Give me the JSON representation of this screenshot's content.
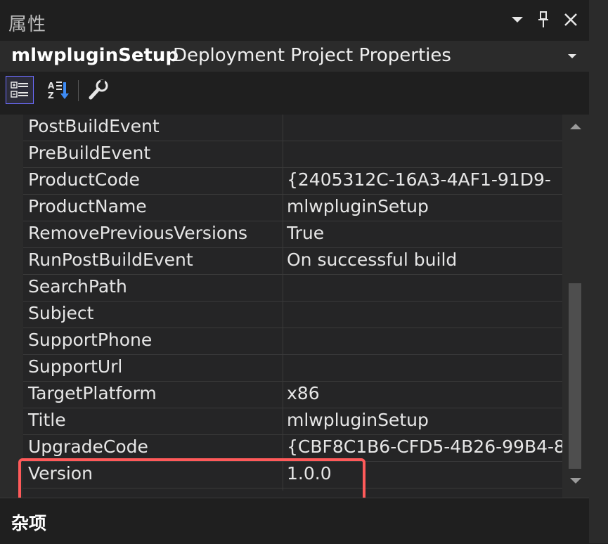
{
  "window": {
    "title": "属性",
    "dropdown_icon": "chevron-down-icon",
    "pin_icon": "pin-icon",
    "close_icon": "close-icon"
  },
  "object_selector": {
    "name": "mlwpluginSetup",
    "type": "Deployment Project Properties"
  },
  "toolbar": {
    "categorized_icon": "categorized-view-icon",
    "alphabetical_icon": "alphabetical-sort-icon",
    "property_pages_icon": "wrench-icon"
  },
  "properties": [
    {
      "name": "PostBuildEvent",
      "value": ""
    },
    {
      "name": "PreBuildEvent",
      "value": ""
    },
    {
      "name": "ProductCode",
      "value": "{2405312C-16A3-4AF1-91D9-"
    },
    {
      "name": "ProductName",
      "value": "mlwpluginSetup"
    },
    {
      "name": "RemovePreviousVersions",
      "value": "True"
    },
    {
      "name": "RunPostBuildEvent",
      "value": "On successful build"
    },
    {
      "name": "SearchPath",
      "value": ""
    },
    {
      "name": "Subject",
      "value": ""
    },
    {
      "name": "SupportPhone",
      "value": ""
    },
    {
      "name": "SupportUrl",
      "value": ""
    },
    {
      "name": "TargetPlatform",
      "value": "x86"
    },
    {
      "name": "Title",
      "value": "mlwpluginSetup"
    },
    {
      "name": "UpgradeCode",
      "value": "{CBF8C1B6-CFD5-4B26-99B4-8"
    },
    {
      "name": "Version",
      "value": "1.0.0"
    }
  ],
  "description": {
    "title": "杂项"
  },
  "colors": {
    "highlight": "#ff5a5a",
    "active_tool_border": "#6c6cff"
  }
}
